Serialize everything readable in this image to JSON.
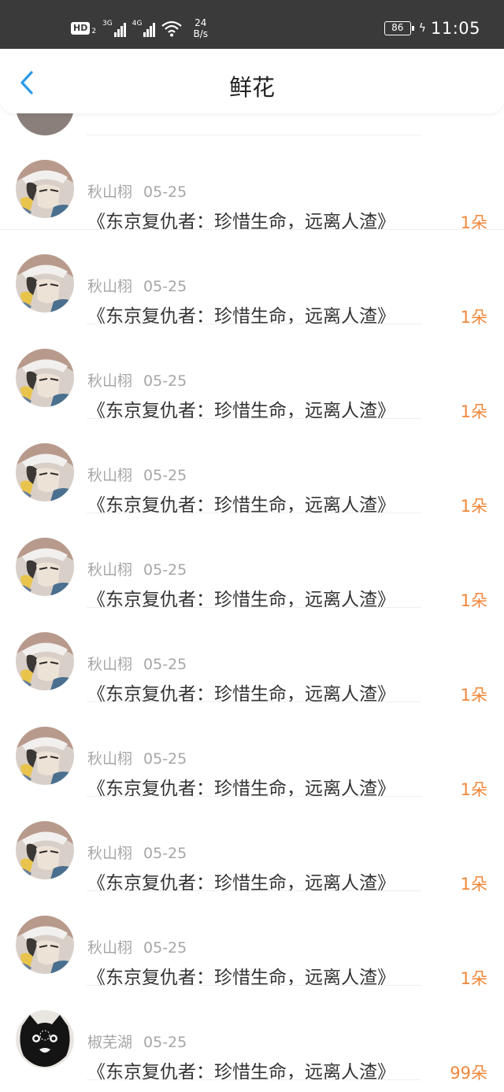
{
  "status_bar": {
    "hd": "HD",
    "hd_sub": "2",
    "net1": "3G",
    "net2": "4G",
    "speed_value": "24",
    "speed_unit": "B/s",
    "battery": "86",
    "time": "11:05"
  },
  "header": {
    "title": "鲜花"
  },
  "items": [
    {
      "user": "秋山栩",
      "date": "05-25",
      "book": "《东京复仇者：珍惜生命，远离人渣》",
      "count": "1朵",
      "avatar": "anime-character-avatar"
    },
    {
      "user": "秋山栩",
      "date": "05-25",
      "book": "《东京复仇者：珍惜生命，远离人渣》",
      "count": "1朵",
      "avatar": "anime-character-avatar"
    },
    {
      "user": "秋山栩",
      "date": "05-25",
      "book": "《东京复仇者：珍惜生命，远离人渣》",
      "count": "1朵",
      "avatar": "anime-character-avatar"
    },
    {
      "user": "秋山栩",
      "date": "05-25",
      "book": "《东京复仇者：珍惜生命，远离人渣》",
      "count": "1朵",
      "avatar": "anime-character-avatar"
    },
    {
      "user": "秋山栩",
      "date": "05-25",
      "book": "《东京复仇者：珍惜生命，远离人渣》",
      "count": "1朵",
      "avatar": "anime-character-avatar"
    },
    {
      "user": "秋山栩",
      "date": "05-25",
      "book": "《东京复仇者：珍惜生命，远离人渣》",
      "count": "1朵",
      "avatar": "anime-character-avatar"
    },
    {
      "user": "秋山栩",
      "date": "05-25",
      "book": "《东京复仇者：珍惜生命，远离人渣》",
      "count": "1朵",
      "avatar": "anime-character-avatar"
    },
    {
      "user": "秋山栩",
      "date": "05-25",
      "book": "《东京复仇者：珍惜生命，远离人渣》",
      "count": "1朵",
      "avatar": "anime-character-avatar"
    },
    {
      "user": "秋山栩",
      "date": "05-25",
      "book": "《东京复仇者：珍惜生命，远离人渣》",
      "count": "1朵",
      "avatar": "anime-character-avatar"
    },
    {
      "user": "椒芜湖",
      "date": "05-25",
      "book": "《东京复仇者：珍惜生命，远离人渣》",
      "count": "99朵",
      "avatar": "black-cat-avatar"
    }
  ],
  "colors": {
    "status_bar_bg": "#3a3a3a",
    "accent_blue": "#2b9be6",
    "count_orange": "#f0873a",
    "meta_gray": "#a6a6a6",
    "text_dark": "#333333"
  }
}
